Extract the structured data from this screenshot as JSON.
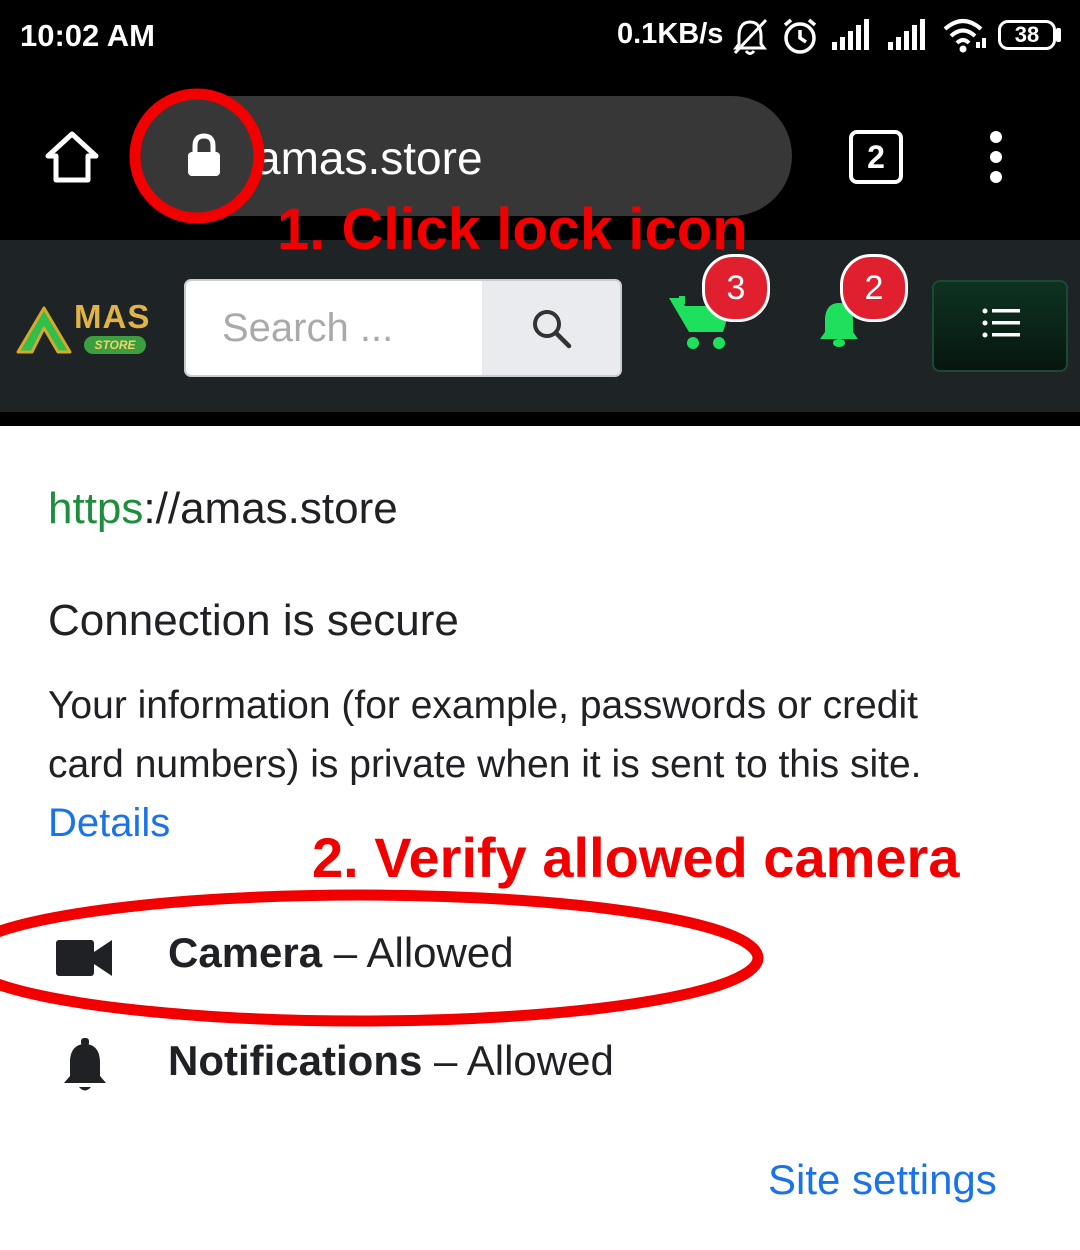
{
  "status_bar": {
    "time": "10:02 AM",
    "network_speed": "0.1KB/s",
    "battery": "38",
    "icons": [
      "notifications-muted-icon",
      "alarm-icon",
      "signal-1-icon",
      "signal-2-icon",
      "wifi-icon",
      "battery-icon"
    ]
  },
  "browser": {
    "url_display": "amas.store",
    "tab_count": "2",
    "icons": [
      "home-icon",
      "lock-icon",
      "overflow-menu-icon"
    ]
  },
  "site": {
    "logo_text": "MAS",
    "logo_subtext": "STORE",
    "search_placeholder": "Search ...",
    "cart_count": "3",
    "notification_count": "2",
    "colors": {
      "header_bg": "#1e2325",
      "accent_green": "#1fe05c",
      "badge_red": "#e01f2f"
    }
  },
  "popup": {
    "url_scheme": "https",
    "url_rest": "://amas.store",
    "connection_title": "Connection is secure",
    "connection_desc_line1": "Your information (for example, passwords or credit",
    "connection_desc_line2": "card numbers) is private when it is sent to this site.",
    "details_link": "Details",
    "permissions": [
      {
        "name": "Camera",
        "status": "Allowed",
        "icon": "camera-icon"
      },
      {
        "name": "Notifications",
        "status": "Allowed",
        "icon": "bell-icon"
      }
    ],
    "separator": "–",
    "site_settings_link": "Site settings"
  },
  "annotations": {
    "step1": "1. Click lock icon",
    "step2": "2. Verify allowed camera",
    "highlight_color": "#f20000"
  }
}
